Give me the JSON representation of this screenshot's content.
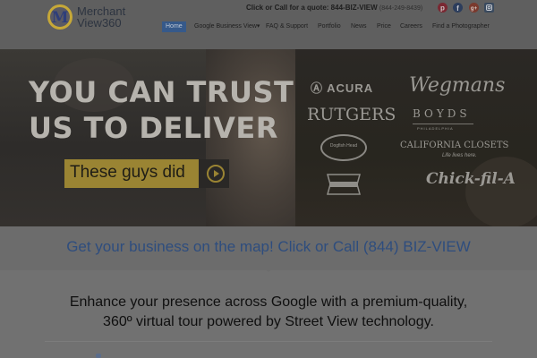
{
  "header": {
    "logo_initial": "M",
    "logo_name": "Merchant",
    "logo_sub": "View360",
    "quote_text": "Click or Call for a quote: 844-BIZ-VIEW",
    "quote_digits": "(844-249-8439)",
    "social_icons": [
      "pinterest-icon",
      "facebook-icon",
      "google-plus-icon",
      "instagram-icon"
    ]
  },
  "nav": {
    "items": [
      {
        "label": "Home",
        "active": true
      },
      {
        "label": "Google Business View",
        "dropdown": true
      },
      {
        "label": "FAQ & Support"
      },
      {
        "label": "Portfolio"
      },
      {
        "label": "News"
      },
      {
        "label": "Price"
      },
      {
        "label": "Careers"
      },
      {
        "label": "Find a Photographer"
      }
    ]
  },
  "hero": {
    "headline_line1": "YOU CAN TRUST",
    "headline_line2": "US TO DELIVER",
    "cta_label": "These guys did",
    "brands": {
      "acura": "ACURA",
      "wegmans": "Wegmans",
      "rutgers": "RUTGERS",
      "boyds": "BOYDS",
      "boyds_sub": "PHILADELPHIA",
      "dogfish": "Dogfish Head",
      "closets": "CALIFORNIA CLOSETS",
      "closets_sub": "Life lives here.",
      "chick": "Chick-fil-A"
    }
  },
  "cta_banner": {
    "text": "Get your business on the map! Click or Call (844) BIZ-VIEW"
  },
  "intro": {
    "line1": "Enhance your presence across Google with a premium-quality,",
    "line2": "360º virtual tour powered by Street View technology."
  },
  "colors": {
    "accent": "#36598a",
    "cta_gold": "#9a8433",
    "link_blue": "#2e4d7e"
  }
}
